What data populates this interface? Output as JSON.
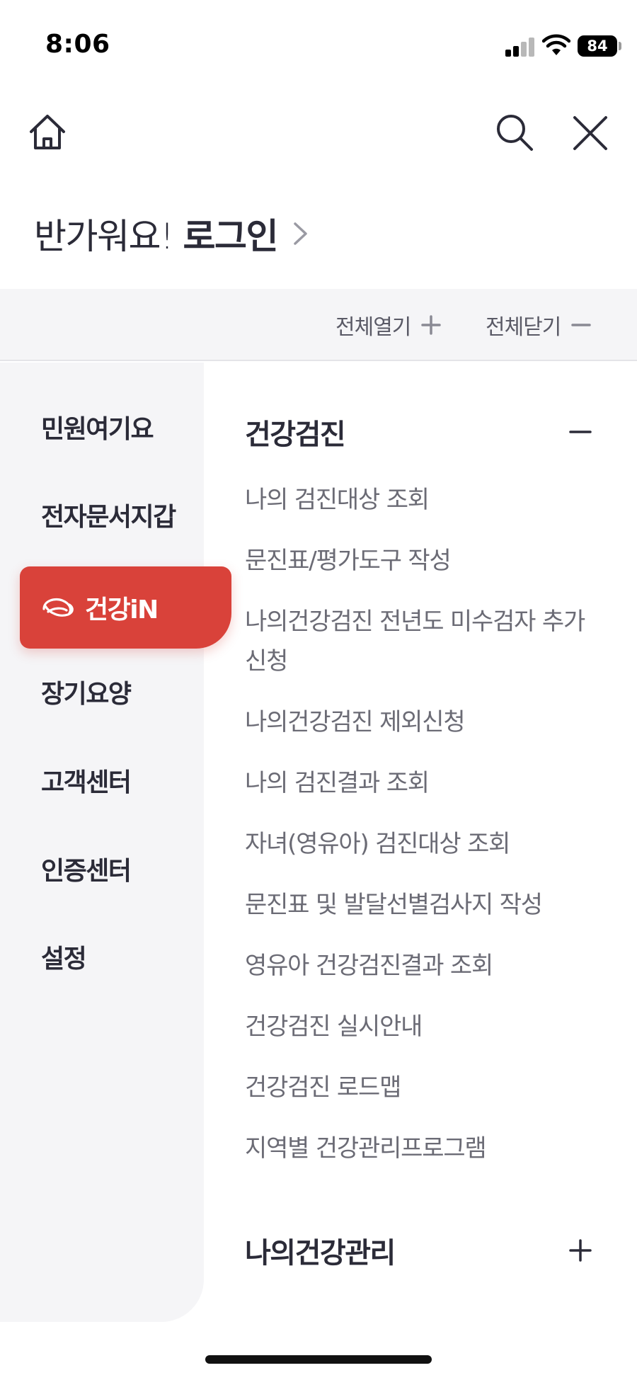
{
  "status_bar": {
    "time": "8:06",
    "battery": "84",
    "icons": [
      "cellular-signal-icon",
      "wifi-icon",
      "battery-icon"
    ]
  },
  "nav": {
    "icons": [
      "home-icon",
      "search-icon",
      "close-icon"
    ]
  },
  "greeting": {
    "text": "반가워요!",
    "login_label": "로그인",
    "icon": "chevron-right-icon"
  },
  "toggles": {
    "expand_all": "전체열기",
    "collapse_all": "전체닫기"
  },
  "sidebar": {
    "items": [
      {
        "label": "민원여기요",
        "active": false
      },
      {
        "label": "전자문서지갑",
        "active": false
      },
      {
        "label": "건강iN",
        "active": true,
        "icon": "health-logo-icon"
      },
      {
        "label": "장기요양",
        "active": false
      },
      {
        "label": "고객센터",
        "active": false
      },
      {
        "label": "인증센터",
        "active": false
      },
      {
        "label": "설정",
        "active": false
      }
    ]
  },
  "sections": [
    {
      "title": "건강검진",
      "expanded": true,
      "toggle_icon": "minus-icon",
      "items": [
        "나의 검진대상 조회",
        "문진표/평가도구 작성",
        "나의건강검진 전년도 미수검자 추가신청",
        "나의건강검진 제외신청",
        "나의 검진결과 조회",
        "자녀(영유아) 검진대상 조회",
        "문진표 및 발달선별검사지 작성",
        "영유아 건강검진결과 조회",
        "건강검진 실시안내",
        "건강검진 로드맵",
        "지역별 건강관리프로그램"
      ]
    },
    {
      "title": "나의건강관리",
      "expanded": false,
      "toggle_icon": "plus-icon"
    }
  ],
  "colors": {
    "accent": "#d9423a",
    "text_dark": "#2b2b38",
    "text_muted": "#6b6b75",
    "panel_bg": "#f5f5f7"
  }
}
